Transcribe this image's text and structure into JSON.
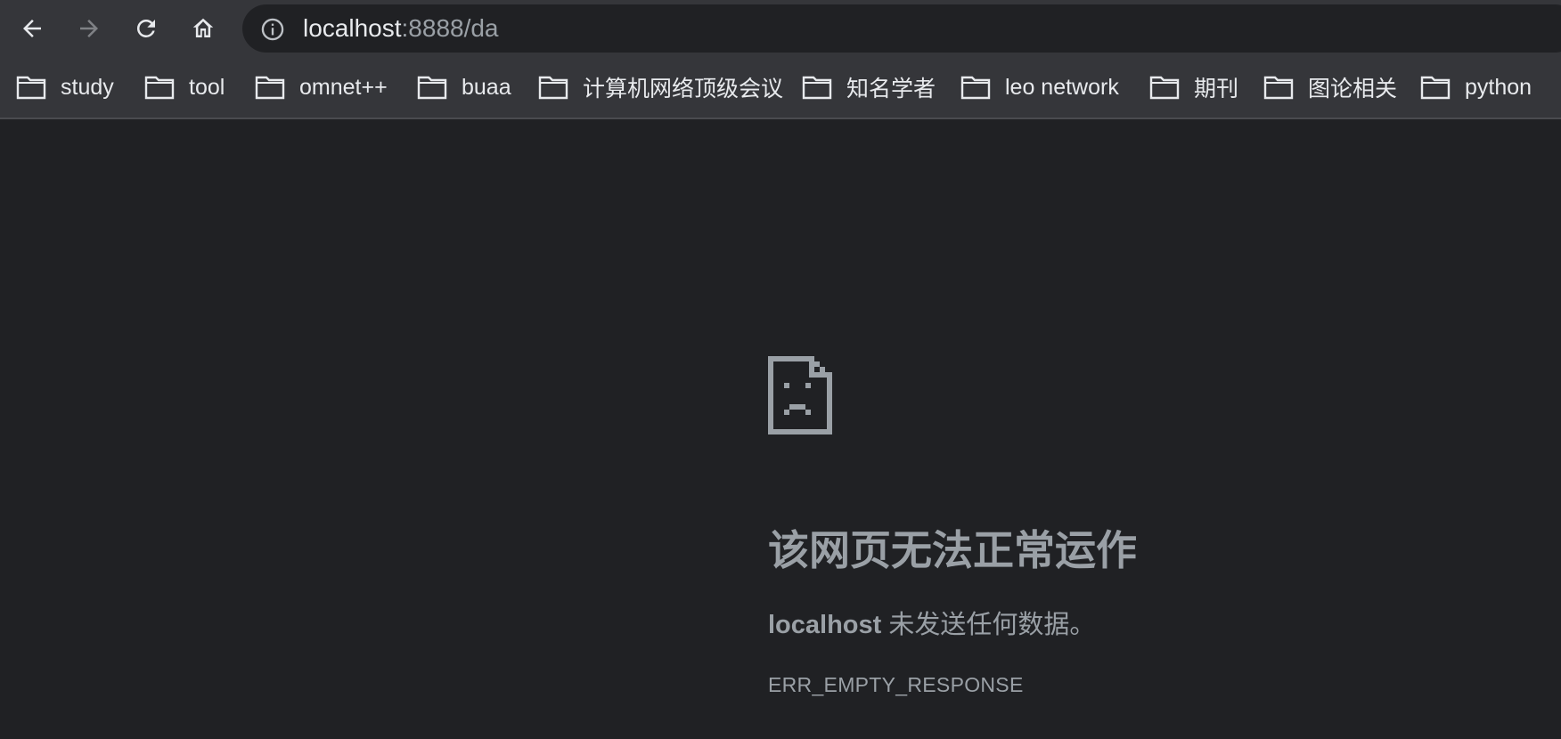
{
  "toolbar": {
    "back_icon": "arrow-left-icon",
    "forward_icon": "arrow-right-icon",
    "reload_icon": "reload-icon",
    "home_icon": "home-icon",
    "omnibox": {
      "info_icon": "info-icon",
      "url_host": "localhost",
      "url_rest": ":8888/da"
    }
  },
  "bookmarks": [
    {
      "label": "study",
      "icon": "folder-icon"
    },
    {
      "label": "tool",
      "icon": "folder-icon"
    },
    {
      "label": "omnet++",
      "icon": "folder-icon"
    },
    {
      "label": "buaa",
      "icon": "folder-icon"
    },
    {
      "label": "计算机网络顶级会议",
      "icon": "folder-icon"
    },
    {
      "label": "知名学者",
      "icon": "folder-icon"
    },
    {
      "label": "leo network",
      "icon": "folder-icon"
    },
    {
      "label": "期刊",
      "icon": "folder-icon"
    },
    {
      "label": "图论相关",
      "icon": "folder-icon"
    },
    {
      "label": "python",
      "icon": "folder-icon"
    }
  ],
  "error_page": {
    "icon": "sad-page-icon",
    "title": "该网页无法正常运作",
    "host": "localhost",
    "description": " 未发送任何数据。",
    "code": "ERR_EMPTY_RESPONSE"
  },
  "colors": {
    "toolbar_bg": "#35363a",
    "page_bg": "#202124",
    "text_primary": "#e8eaed",
    "text_secondary": "#9aa0a6"
  }
}
